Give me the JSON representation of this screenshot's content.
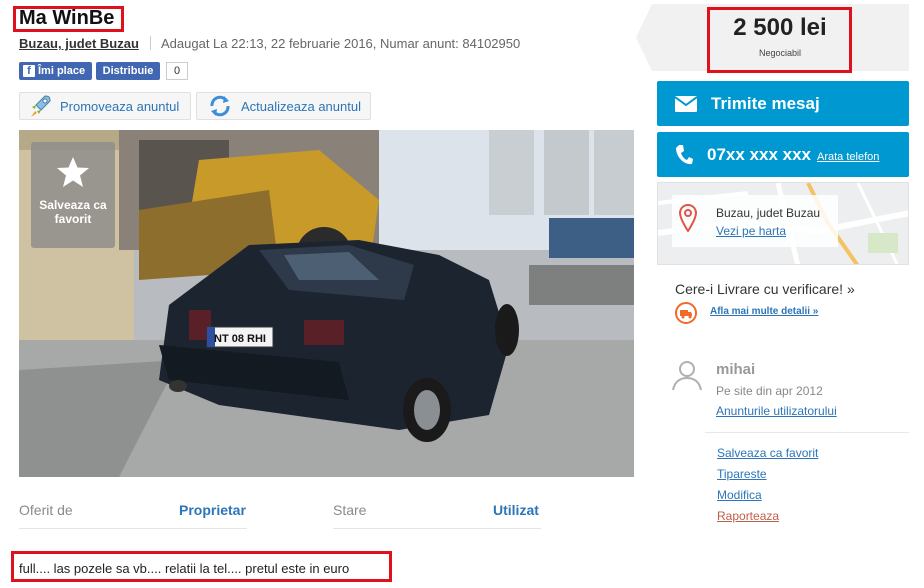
{
  "listing": {
    "title": "Ma WinBe",
    "location": "Buzau, judet Buzau",
    "meta": "Adaugat La 22:13, 22 februarie 2016, Numar anunt: 84102950"
  },
  "social": {
    "like_label": "Îmi place",
    "share_label": "Distribuie",
    "count": "0",
    "brand_color": "#4267b2"
  },
  "actions": {
    "promote_label": "Promoveaza anuntul",
    "update_label": "Actualizeaza anuntul"
  },
  "photo": {
    "save_label": "Salveaza ca favorit",
    "plate": "NT 08 RHI"
  },
  "attributes": [
    {
      "label": "Oferit de",
      "value": "Proprietar"
    },
    {
      "label": "Stare",
      "value": "Utilizat"
    }
  ],
  "description": "full.... las pozele sa vb.... relatii la tel.... pretul este in euro",
  "price": {
    "amount": "2 500 lei",
    "note": "Negociabil"
  },
  "contact": {
    "message_label": "Trimite mesaj",
    "phone": "07xx xxx xxx",
    "show_phone_label": "Arata telefon",
    "accent_color": "#0098d0"
  },
  "map": {
    "location": "Buzau, judet Buzau",
    "view_label": "Vezi pe harta"
  },
  "delivery": {
    "title": "Cere-i Livrare cu verificare! »",
    "details_label": "Afla mai multe detalii »"
  },
  "user": {
    "name": "mihai",
    "since": "Pe site din apr 2012",
    "ads_label": "Anunturile utilizatorului"
  },
  "side_links": {
    "save": "Salveaza ca favorit",
    "print": "Tipareste",
    "edit": "Modifica",
    "report": "Raporteaza"
  },
  "annotation_color": "#e0101c"
}
